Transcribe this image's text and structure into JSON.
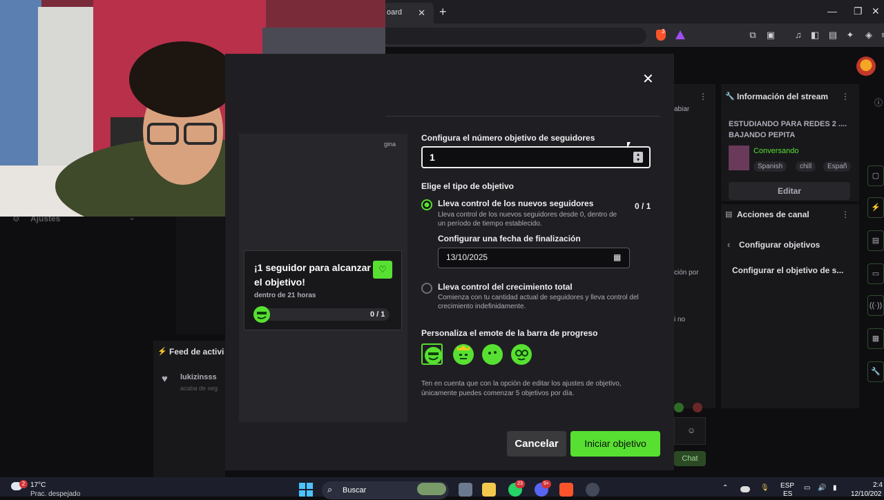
{
  "browser": {
    "tab_title": "oard",
    "tab_close": "✕",
    "new_tab": "+",
    "window_controls": [
      "—",
      "❐",
      "✕"
    ],
    "brave_badge": "3"
  },
  "dashboard": {
    "stream_info_title": "Información del stream",
    "stream_title": "ESTUDIANDO PARA REDES 2 .... BAJANDO PEPITA",
    "category": "Conversando",
    "tags": [
      "Spanish",
      "chill",
      "Españ"
    ],
    "edit_button": "Editar",
    "channel_actions_title": "Acciones de canal",
    "configure_goals": "Configurar objetivos",
    "configure_goal_item": "Configurar el objetivo de s...",
    "activity_feed_title": "Feed de activi",
    "activity_user": "lukizinsss",
    "activity_desc": "acaba de seg",
    "settings_label": "Ajustes",
    "chat_button": "Chat",
    "left_frag_1": "abiar",
    "left_frag_2": "ción por",
    "left_frag_3": "i no",
    "left_frag_4": "gina"
  },
  "modal": {
    "close": "✕",
    "preview": {
      "title": "¡1 seguidor para alcanzar el objetivo!",
      "subtitle": "dentro de 21 horas",
      "count": "0 / 1"
    },
    "target_label": "Configura el número objetivo de seguidores",
    "target_value": "1",
    "type_label": "Elige el tipo de objetivo",
    "option_new": {
      "title": "Lleva control de los nuevos seguidores",
      "desc": "Lleva control de los nuevos seguidores desde 0, dentro de un período de tiempo establecido.",
      "count": "0 / 1"
    },
    "end_date_label": "Configurar una fecha de finalización",
    "end_date_value": "13/10/2025",
    "option_total": {
      "title": "Lleva control del crecimiento total",
      "desc": "Comienza con tu cantidad actual de seguidores y lleva control del crecimiento indefinidamente."
    },
    "emote_label": "Personaliza el emote de la barra de progreso",
    "note": "Ten en cuenta que con la opción de editar los ajustes de objetivo, únicamente puedes comenzar 5 objetivos por día.",
    "cancel_button": "Cancelar",
    "start_button": "Iniciar objetivo"
  },
  "taskbar": {
    "weather_temp": "17°C",
    "weather_desc": "Prac. despejado",
    "weather_badge": "2",
    "search_placeholder": "Buscar",
    "whatsapp_badge": "23",
    "discord_badge": "9+",
    "language": "ESP",
    "language_sub": "ES",
    "time": "2:4",
    "date": "12/10/202"
  },
  "colors": {
    "accent_green": "#57e031",
    "background": "#0e0e10",
    "modal": "#1f1f23"
  }
}
